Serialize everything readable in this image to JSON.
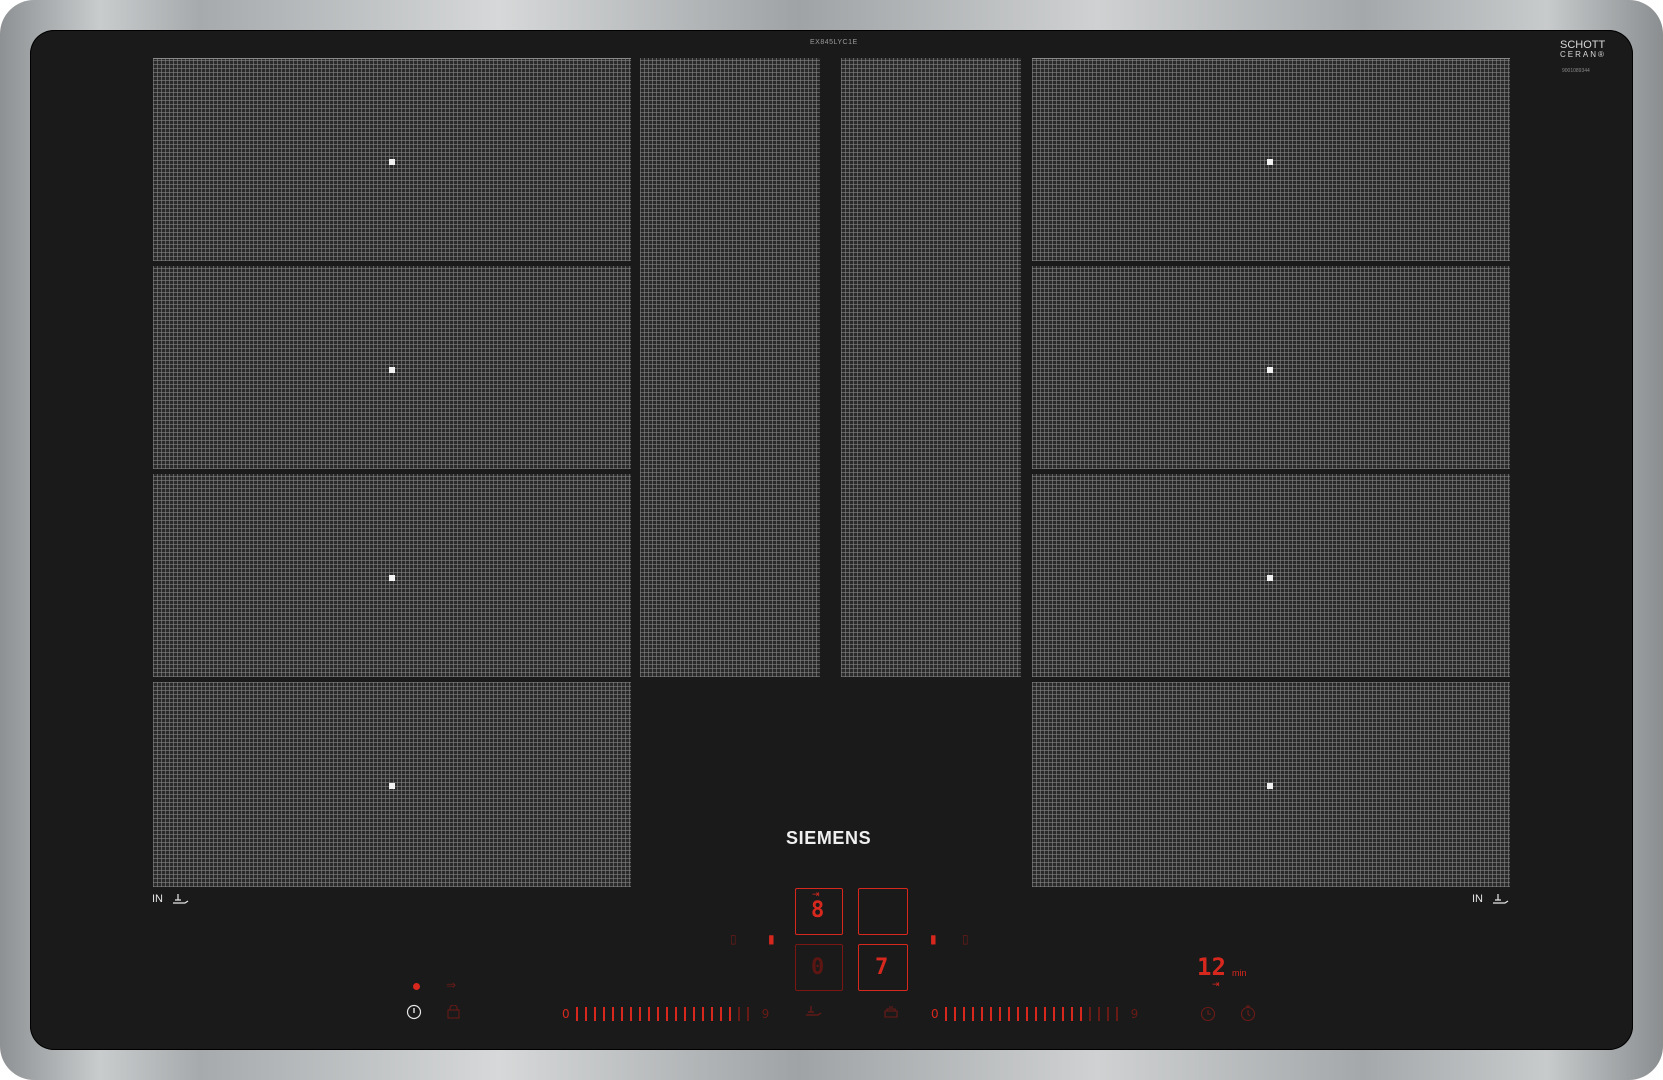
{
  "model_label": "EX845LYC1E",
  "brand": "SIEMENS",
  "glass_brand": {
    "line1": "SCHOTT",
    "line2": "CERAN®"
  },
  "serial": "9001089344",
  "flex_labels": {
    "left": "IN",
    "right": "IN"
  },
  "power_level_display": "8",
  "zone_displays": {
    "left": "0",
    "right": "7"
  },
  "timer": {
    "value": "12",
    "unit": "min"
  },
  "slider_scale": {
    "start": "0",
    "end": "9"
  },
  "colors": {
    "control_red": "#d8281e",
    "glass": "#1a1a1a",
    "frame": "#b9bcbd"
  },
  "icons": {
    "power": "power-icon",
    "lock": "childlock-icon",
    "wipe": "wipe-protection-icon",
    "powerboost": "powerboost-icon",
    "shield": "keep-warm-icon",
    "timer": "timer-icon",
    "stopwatch": "stopwatch-icon",
    "pot": "flex-pot-icon",
    "recipe": "frying-sensor-icon"
  }
}
